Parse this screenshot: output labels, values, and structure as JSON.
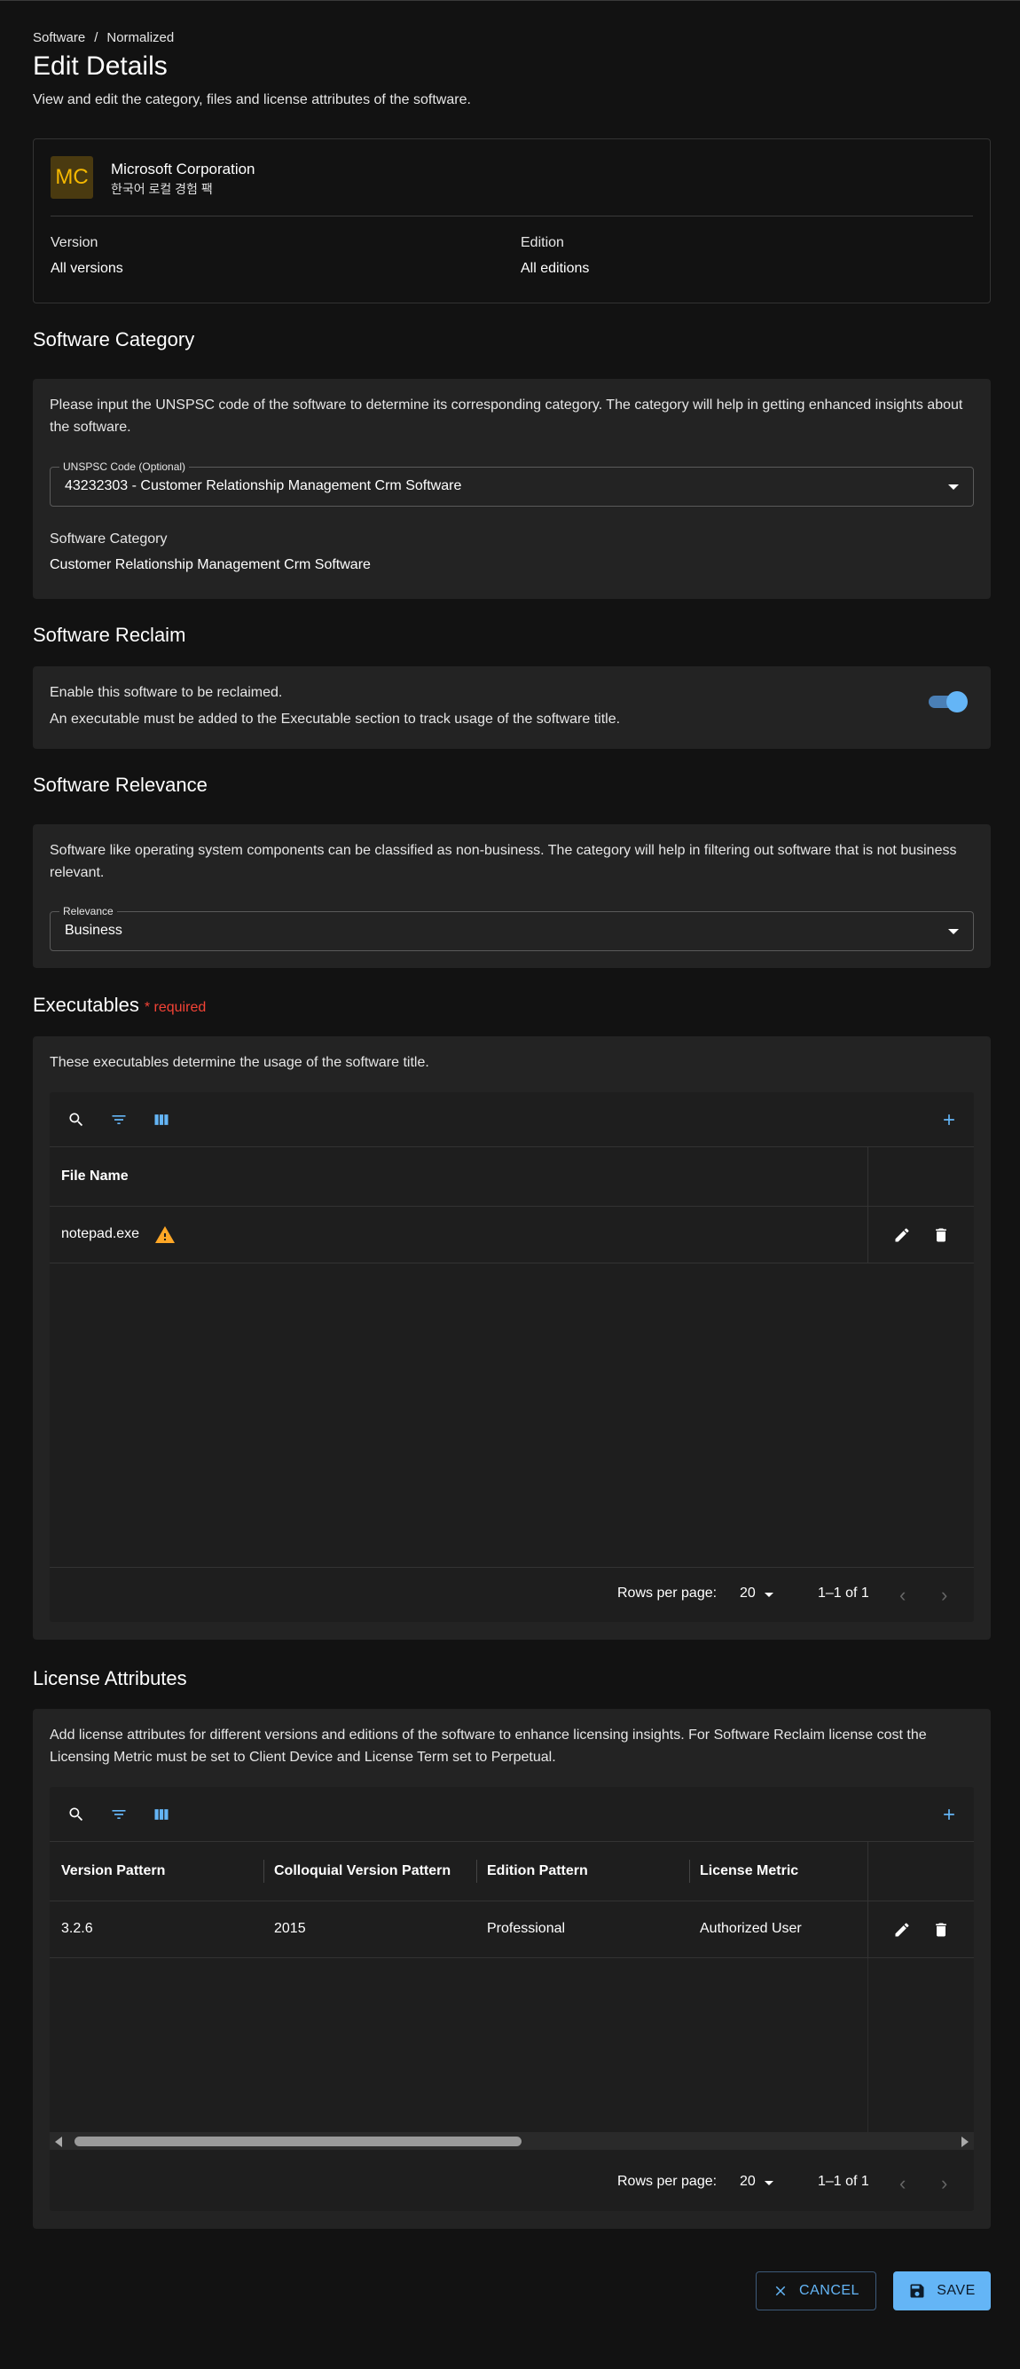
{
  "breadcrumb": {
    "root": "Software",
    "separator": "/",
    "current": "Normalized"
  },
  "header": {
    "title": "Edit Details",
    "subtitle": "View and edit the category, files and license attributes of the software."
  },
  "publisher": {
    "initials": "MC",
    "name": "Microsoft Corporation",
    "product": "한국어 로컬 경험 팩",
    "version_label": "Version",
    "version_value": "All versions",
    "edition_label": "Edition",
    "edition_value": "All editions"
  },
  "category": {
    "title": "Software Category",
    "description": "Please input the UNSPSC code of the software to determine its corresponding category. The category will help in getting enhanced insights about the software.",
    "field_label": "UNSPSC Code (Optional)",
    "field_value": "43232303 - Customer Relationship Management Crm Software",
    "category_label": "Software Category",
    "category_value": "Customer Relationship Management Crm Software"
  },
  "reclaim": {
    "title": "Software Reclaim",
    "line1": "Enable this software to be reclaimed.",
    "line2": "An executable must be added to the Executable section to track usage of the software title.",
    "enabled": true
  },
  "relevance": {
    "title": "Software Relevance",
    "description": "Software like operating system components can be classified as non-business. The category will help in filtering out software that is not business relevant.",
    "field_label": "Relevance",
    "field_value": "Business"
  },
  "executables": {
    "title": "Executables",
    "required": "* required",
    "description": "These executables determine the usage of the software title.",
    "columns": [
      "File Name"
    ],
    "rows": [
      {
        "file": "notepad.exe"
      }
    ],
    "footer": {
      "rows_per_page_label": "Rows per page:",
      "rows_per_page": "20",
      "range": "1–1 of 1"
    }
  },
  "license": {
    "title": "License Attributes",
    "description": "Add license attributes for different versions and editions of the software to enhance licensing insights. For Software Reclaim license cost the Licensing Metric must be set to Client Device and License Term set to Perpetual.",
    "columns": [
      "Version Pattern",
      "Colloquial Version Pattern",
      "Edition Pattern",
      "License Metric"
    ],
    "rows": [
      {
        "version": "3.2.6",
        "colloquial": "2015",
        "edition": "Professional",
        "metric": "Authorized User"
      }
    ],
    "footer": {
      "rows_per_page_label": "Rows per page:",
      "rows_per_page": "20",
      "range": "1–1 of 1"
    }
  },
  "actions": {
    "cancel": "CANCEL",
    "save": "SAVE"
  },
  "colors": {
    "accent": "#64b5f6",
    "warning": "#ffa726",
    "required": "#f44336",
    "avatar_bg": "#4a3a10",
    "avatar_fg": "#f5b800"
  }
}
